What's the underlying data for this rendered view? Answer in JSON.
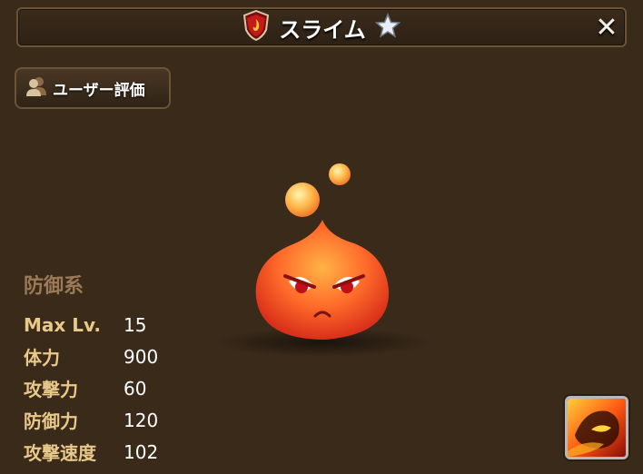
{
  "header": {
    "title": "スライム"
  },
  "review_button": {
    "label": "ユーザー評価"
  },
  "monster": {
    "category": "防御系",
    "stats": [
      {
        "label": "Max Lv.",
        "value": "15"
      },
      {
        "label": "体力",
        "value": "900"
      },
      {
        "label": "攻撃力",
        "value": "60"
      },
      {
        "label": "防御力",
        "value": "120"
      },
      {
        "label": "攻撃速度",
        "value": "102"
      }
    ],
    "element": "fire",
    "stars": 1
  },
  "icons": {
    "attribute": "fire-attribute-icon",
    "star": "star-icon",
    "close": "close-icon",
    "review": "users-icon",
    "skill": "fire-skill-icon"
  },
  "colors": {
    "background": "#3a2a1a",
    "stat_label": "#e9c98a",
    "category": "#9b7a55",
    "border": "#6b5435"
  }
}
